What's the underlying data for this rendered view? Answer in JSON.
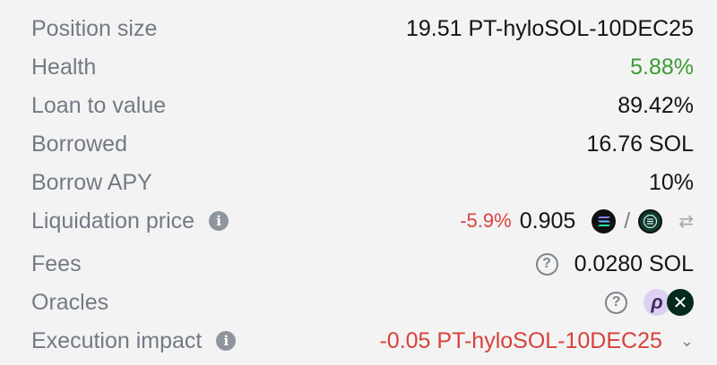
{
  "rows": [
    {
      "label": "Position size",
      "value": "19.51 PT-hyloSOL-10DEC25"
    },
    {
      "label": "Health",
      "value": "5.88%",
      "value_color": "#3b9b2f"
    },
    {
      "label": "Loan to value",
      "value": "89.42%"
    },
    {
      "label": "Borrowed",
      "value": "16.76 SOL"
    },
    {
      "label": "Borrow APY",
      "value": "10%"
    },
    {
      "label": "Liquidation price",
      "change": "-5.9%",
      "value": "0.905",
      "divider": "/",
      "info_icon": "info-icon",
      "swap_icon": "swap-icon"
    },
    {
      "label": "Fees",
      "value": "0.0280 SOL",
      "help_icon": "question-mark-icon"
    },
    {
      "label": "Oracles",
      "help_icon": "question-mark-icon",
      "oracle_icons": [
        "pyth-oracle-icon",
        "switchboard-oracle-icon"
      ]
    },
    {
      "label": "Execution impact",
      "value": "-0.05 PT-hyloSOL-10DEC25",
      "value_color": "#d9413a",
      "info_icon": "info-icon",
      "expand_icon": "chevron-down-icon"
    }
  ],
  "colors": {
    "background": "#f3f3f4",
    "label": "#737a83",
    "value": "#141414",
    "positive": "#3b9b2f",
    "negative": "#d9413a"
  }
}
